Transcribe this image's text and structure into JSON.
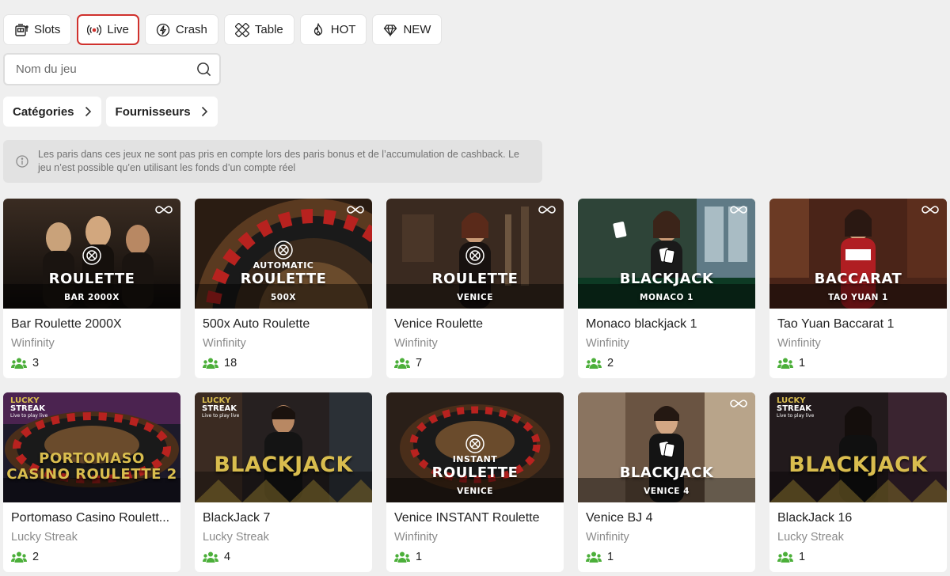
{
  "filters": [
    {
      "label": "Slots",
      "icon": "slot-machine-icon",
      "active": false
    },
    {
      "label": "Live",
      "icon": "live-broadcast-icon",
      "active": true
    },
    {
      "label": "Crash",
      "icon": "crash-lightning-icon",
      "active": false
    },
    {
      "label": "Table",
      "icon": "cards-icon",
      "active": false
    },
    {
      "label": "HOT",
      "icon": "fire-icon",
      "active": false
    },
    {
      "label": "NEW",
      "icon": "diamond-icon",
      "active": false
    }
  ],
  "search": {
    "placeholder": "Nom du jeu"
  },
  "dropdowns": {
    "categories": "Catégories",
    "providers": "Fournisseurs"
  },
  "notice": "Les paris dans ces jeux ne sont pas pris en compte lors des paris bonus et de l’accumulation de cashback. Le jeu n’est possible qu’en utilisant les fonds d’un compte réel",
  "colors": {
    "active_border": "#d0312d",
    "players_icon": "#4caf3a",
    "gold_logo": "#d9bd4e"
  },
  "games": [
    {
      "title": "Bar Roulette 2000X",
      "provider": "Winfinity",
      "players": "3",
      "thumb": {
        "pre": "",
        "main": "ROULETTE",
        "sub": "BAR 2000X"
      }
    },
    {
      "title": "500x Auto Roulette",
      "provider": "Winfinity",
      "players": "18",
      "thumb": {
        "pre": "AUTOMATIC",
        "main": "ROULETTE",
        "sub": "500X"
      }
    },
    {
      "title": "Venice Roulette",
      "provider": "Winfinity",
      "players": "7",
      "thumb": {
        "pre": "",
        "main": "ROULETTE",
        "sub": "VENICE"
      }
    },
    {
      "title": "Monaco blackjack 1",
      "provider": "Winfinity",
      "players": "2",
      "thumb": {
        "pre": "",
        "main": "BLACKJACK",
        "sub": "MONACO 1"
      }
    },
    {
      "title": "Tao Yuan Baccarat 1",
      "provider": "Winfinity",
      "players": "1",
      "thumb": {
        "pre": "",
        "main": "BACCARAT",
        "sub": "TAO YUAN 1"
      }
    },
    {
      "title": "Portomaso Casino Roulett...",
      "provider": "Lucky Streak",
      "players": "2",
      "thumb": {
        "line1": "PORTOMASO",
        "line2": "CASINO ROULETTE 2",
        "lucky": [
          "LUCKY",
          "STREAK",
          "Live to play live"
        ]
      }
    },
    {
      "title": "BlackJack 7",
      "provider": "Lucky Streak",
      "players": "4",
      "thumb": {
        "main": "BLACKJACK",
        "lucky": [
          "LUCKY",
          "STREAK",
          "Live to play live"
        ]
      }
    },
    {
      "title": "Venice INSTANT Roulette",
      "provider": "Winfinity",
      "players": "1",
      "thumb": {
        "pre": "INSTANT",
        "main": "ROULETTE",
        "sub": "VENICE"
      }
    },
    {
      "title": "Venice BJ 4",
      "provider": "Winfinity",
      "players": "1",
      "thumb": {
        "pre": "",
        "main": "BLACKJACK",
        "sub": "VENICE 4"
      }
    },
    {
      "title": "BlackJack 16",
      "provider": "Lucky Streak",
      "players": "1",
      "thumb": {
        "main": "BLACKJACK",
        "lucky": [
          "LUCKY",
          "STREAK",
          "Live to play live"
        ]
      }
    }
  ]
}
